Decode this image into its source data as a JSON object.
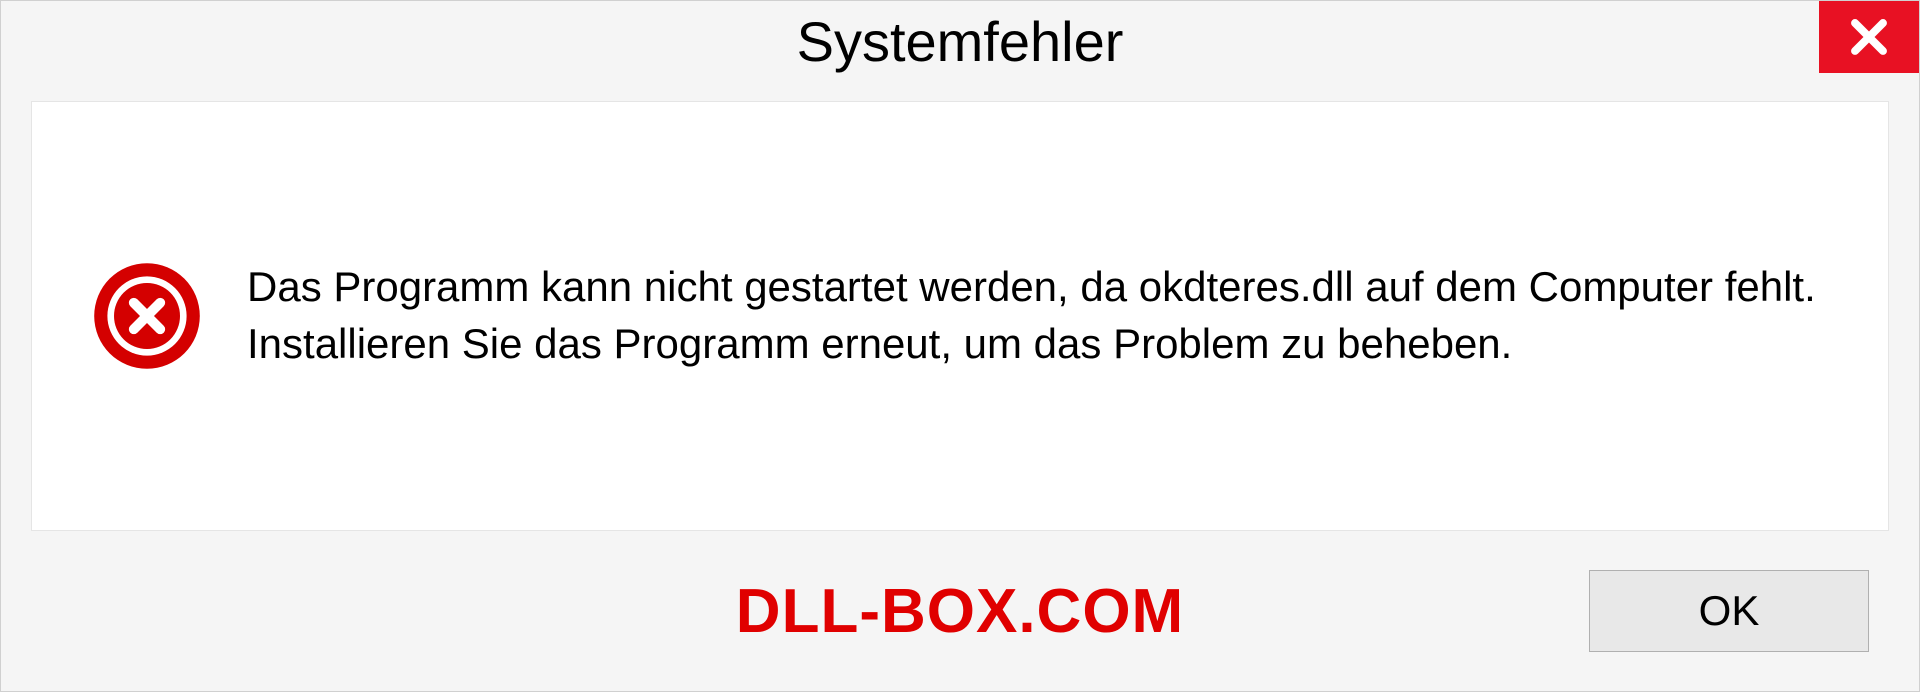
{
  "dialog": {
    "title": "Systemfehler",
    "message": "Das Programm kann nicht gestartet werden, da okdteres.dll auf dem Computer fehlt. Installieren Sie das Programm erneut, um das Problem zu beheben.",
    "ok_label": "OK",
    "watermark": "DLL-BOX.COM"
  }
}
